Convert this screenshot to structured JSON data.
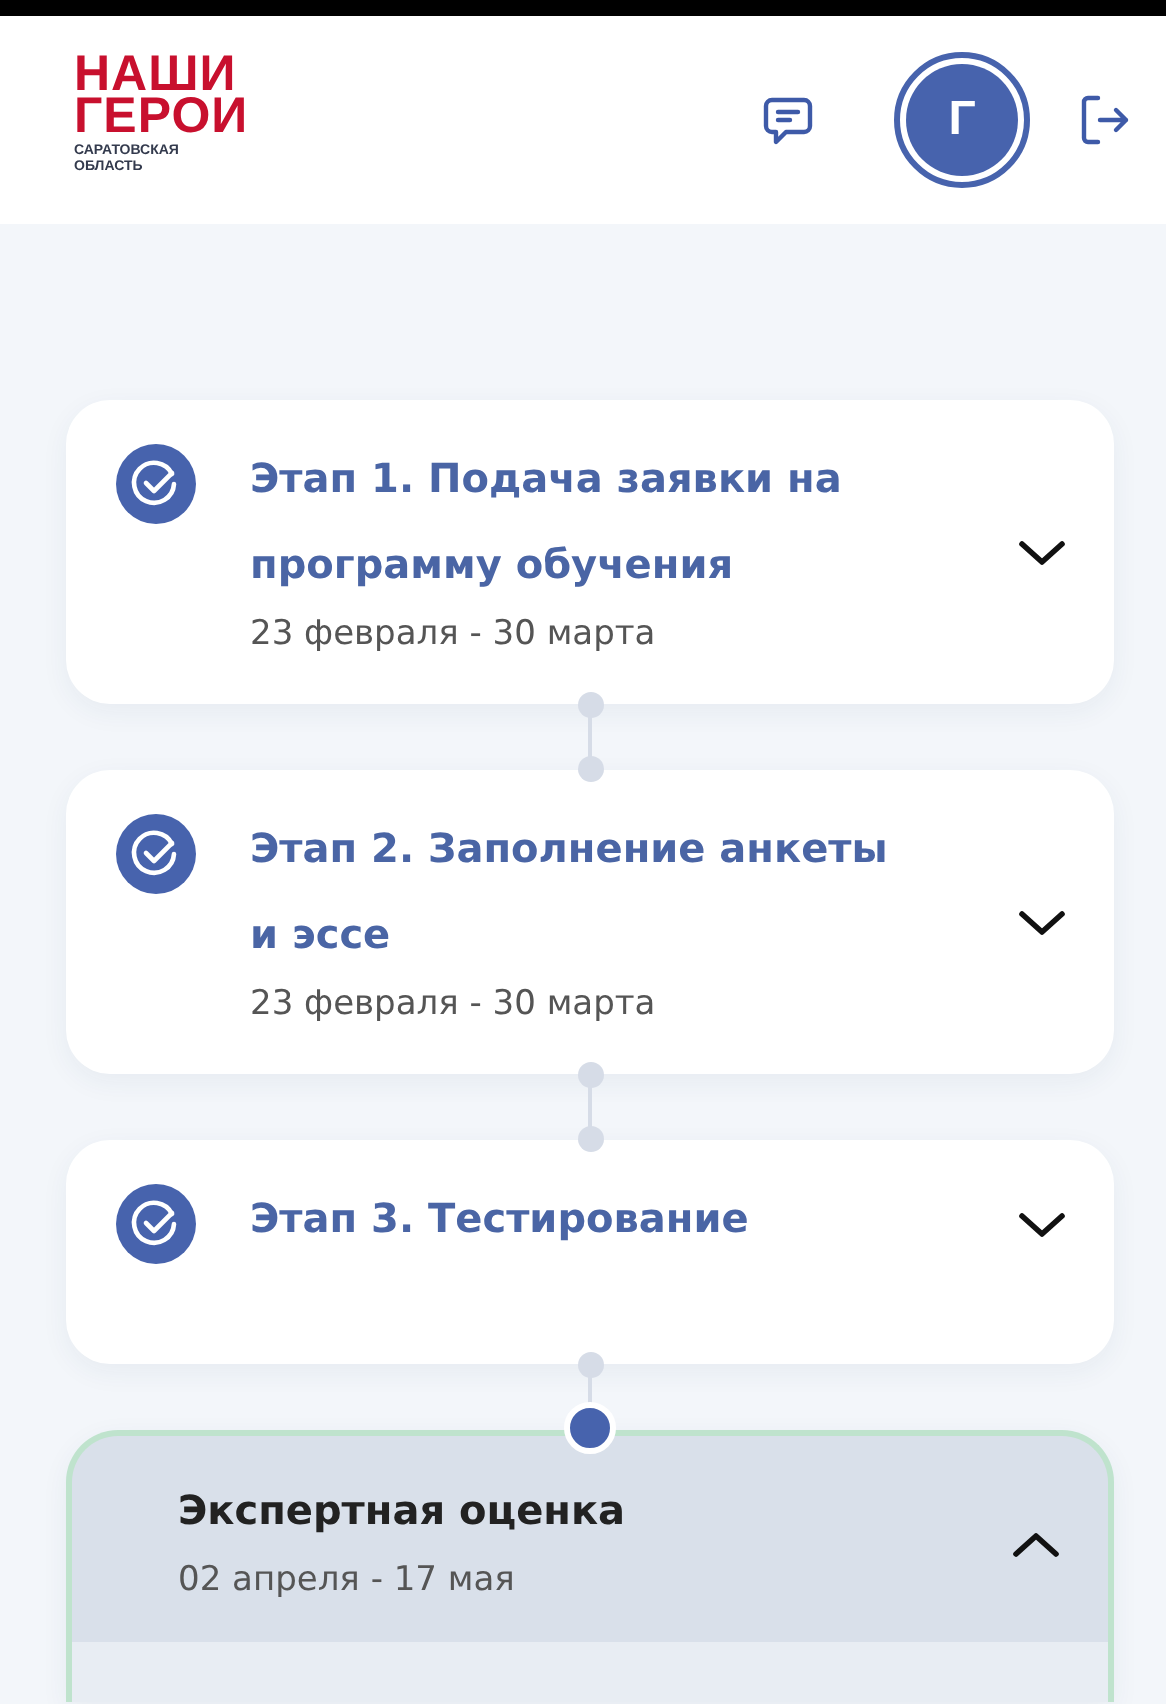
{
  "header": {
    "logo": {
      "title_line_1": "НАШИ",
      "title_line_2": "ГЕРОИ",
      "subtitle_line_1": "САРАТОВСКАЯ",
      "subtitle_line_2": "ОБЛАСТЬ"
    },
    "avatar": {
      "initial": "Г"
    }
  },
  "stages": [
    {
      "kind": "done",
      "title": "Этап 1. Подача заявки на программу обучения",
      "dates": "23 февраля - 30 марта",
      "expanded": false
    },
    {
      "kind": "done",
      "title": "Этап 2. Заполнение анкеты и эссе",
      "dates": "23 февраля - 30 марта",
      "expanded": false
    },
    {
      "kind": "done",
      "title": "Этап 3. Тестирование",
      "expanded": false
    },
    {
      "kind": "active",
      "title": "Экспертная оценка",
      "dates": "02 апреля - 17 мая",
      "expanded": true
    }
  ]
}
